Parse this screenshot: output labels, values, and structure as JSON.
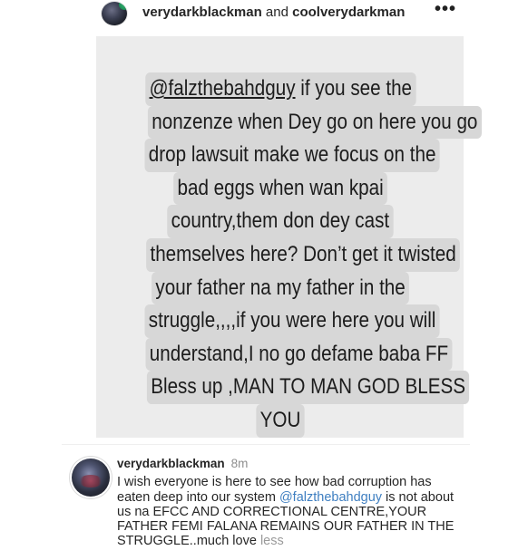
{
  "header": {
    "user1": "verydarkblackman",
    "conjunction": "and",
    "user2": "coolverydarkman",
    "more_icon": "•••"
  },
  "story": {
    "mention": "@falzthebahdguy",
    "first_line_rest": " if you see the",
    "lines": [
      "nonzenze when Dey go on here you go",
      "drop lawsuit make we focus on the",
      "bad eggs when wan kpai",
      "country,them don dey cast",
      "themselves here? Don’t get it twisted",
      "your father na my father in the",
      "struggle,,,,if you were here you will",
      "understand,I no go defame baba FF",
      "Bless up ,MAN TO MAN GOD BLESS",
      "YOU"
    ]
  },
  "comment": {
    "username": "verydarkblackman",
    "time": "8m",
    "text_before_mention": "I wish everyone is here to see how bad corruption has eaten deep into our system ",
    "mention": "@falzthebahdguy",
    "text_after_mention": " is not about us na EFCC AND CORRECTIONAL CENTRE,YOUR FATHER FEMI FALANA REMAINS OUR FATHER IN THE STRUGGLE..much love ",
    "less_label": "less"
  }
}
